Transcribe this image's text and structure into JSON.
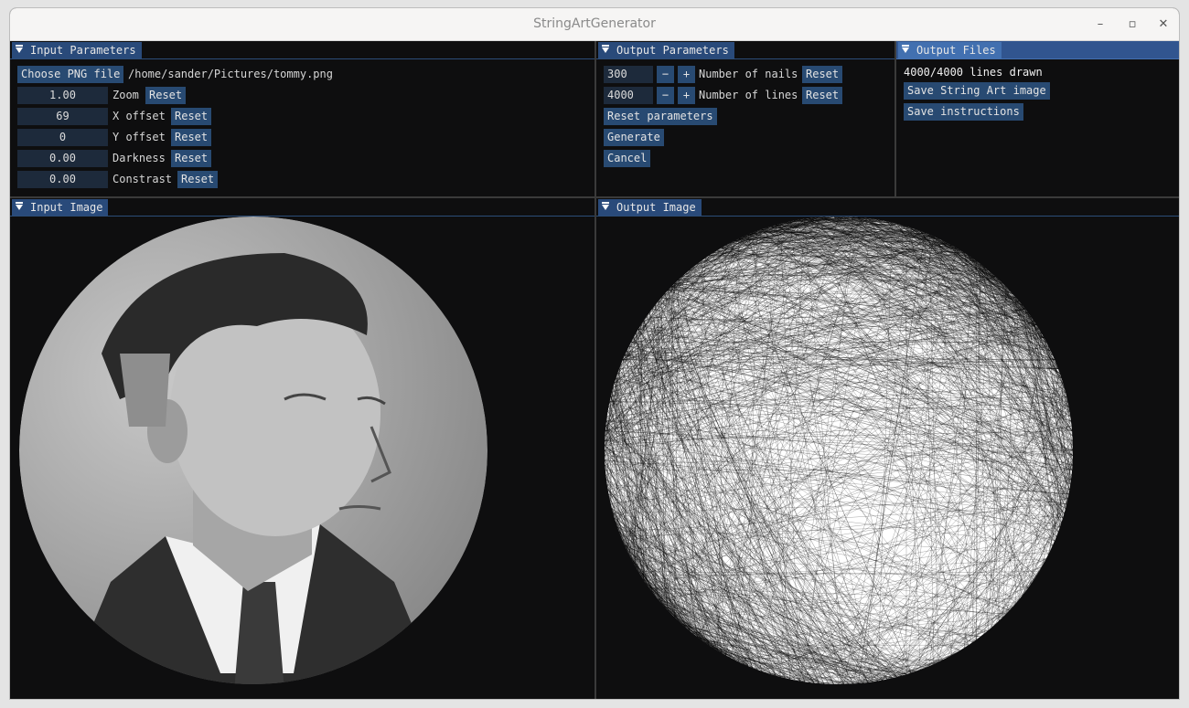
{
  "window": {
    "title": "StringArtGenerator",
    "controls": {
      "minimize": "–",
      "maximize": "▫",
      "close": "✕"
    }
  },
  "input_parameters": {
    "title": "Input Parameters",
    "choose_button": "Choose PNG file",
    "file_path": "/home/sander/Pictures/tommy.png",
    "rows": [
      {
        "value": "1.00",
        "label": "Zoom",
        "reset": "Reset"
      },
      {
        "value": "69",
        "label": "X offset",
        "reset": "Reset"
      },
      {
        "value": "0",
        "label": "Y offset",
        "reset": "Reset"
      },
      {
        "value": "0.00",
        "label": "Darkness",
        "reset": "Reset"
      },
      {
        "value": "0.00",
        "label": "Constrast",
        "reset": "Reset"
      }
    ]
  },
  "output_parameters": {
    "title": "Output Parameters",
    "nails": {
      "value": "300",
      "minus": "−",
      "plus": "+",
      "label": "Number of nails",
      "reset": "Reset"
    },
    "lines": {
      "value": "4000",
      "minus": "−",
      "plus": "+",
      "label": "Number of lines",
      "reset": "Reset"
    },
    "reset_parameters": "Reset parameters",
    "generate": "Generate",
    "cancel": "Cancel"
  },
  "output_files": {
    "title": "Output Files",
    "status": "4000/4000 lines drawn",
    "save_image": "Save String Art image",
    "save_instructions": "Save instructions"
  },
  "input_image": {
    "title": "Input Image"
  },
  "output_image": {
    "title": "Output Image"
  }
}
